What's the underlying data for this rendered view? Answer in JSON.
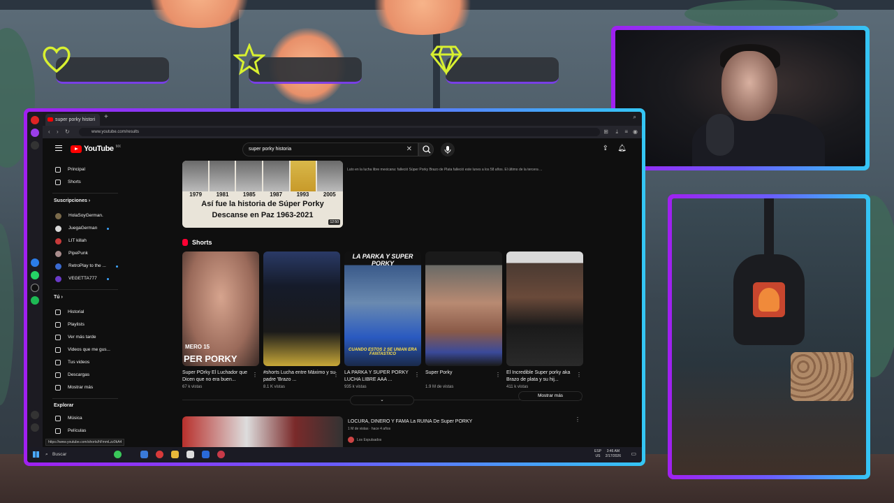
{
  "browser": {
    "tab_title": "super porky histori",
    "url": "www.youtube.com/results"
  },
  "youtube": {
    "logo": "YouTube",
    "country": "MX",
    "search_query": "super porky historia",
    "sidebar": {
      "main": [
        {
          "label": "Principal",
          "icon": "home-icon"
        },
        {
          "label": "Shorts",
          "icon": "shorts-icon"
        }
      ],
      "subscriptions_title": "Suscripciones",
      "subscriptions": [
        {
          "label": "HolaSoyGerman.",
          "color": "#7a6a4a"
        },
        {
          "label": "JuegaGerman",
          "color": "#d8d8d8"
        },
        {
          "label": "LIT killah",
          "color": "#c83a3a"
        },
        {
          "label": "PipePunk",
          "color": "#a88c8c"
        },
        {
          "label": "RetroPlay to the ...",
          "color": "#3a6ad0"
        },
        {
          "label": "VEGETTA777",
          "color": "#6a3ac8"
        }
      ],
      "you_title": "Tú",
      "you_items": [
        {
          "label": "Historial",
          "icon": "history-icon"
        },
        {
          "label": "Playlists",
          "icon": "playlist-icon"
        },
        {
          "label": "Ver más tarde",
          "icon": "clock-icon"
        },
        {
          "label": "Videos que me gus...",
          "icon": "like-icon"
        },
        {
          "label": "Tus videos",
          "icon": "video-icon"
        },
        {
          "label": "Descargas",
          "icon": "download-icon"
        },
        {
          "label": "Mostrar más",
          "icon": "chevron-down-icon"
        }
      ],
      "explore_title": "Explorar",
      "explore_items": [
        {
          "label": "Música",
          "icon": "music-icon"
        },
        {
          "label": "Películas",
          "icon": "film-icon"
        }
      ]
    },
    "top_video": {
      "years": [
        "1979",
        "1981",
        "1985",
        "1987",
        "1993",
        "2005"
      ],
      "title_line1": "Así fue la historia de Súper Porky",
      "title_line2": "Descanse en Paz 1963-2021",
      "duration": "12:50",
      "description": "Luto en la lucha libre mexicana: falleció Súper Porky Brazo de Plata falleció este lunes a los 58 años. El último de la tercera ..."
    },
    "shorts_title": "Shorts",
    "shorts": [
      {
        "title": "Super POrky El Luchador que Dicen que no era buen...",
        "views": "67 k vistas",
        "overlay": "PER PORKY",
        "sub": "MERO 15"
      },
      {
        "title": "#shorts Lucha entre Máximo y su padre 'Brazo ...",
        "views": "8.1 K vistas",
        "overlay": "",
        "sub": ""
      },
      {
        "title": "LA PARKA Y SUPER PORKY LUCHA LIBRE AAA ...",
        "views": "935 k vistas",
        "overlay": "LA PARKA Y SUPER PORKY",
        "sub": "CUANDO ESTOS 2 SE UNIAN ERA FANTASTICO"
      },
      {
        "title": "Super Porky",
        "views": "1.9 M de vistas",
        "overlay": "",
        "sub": ""
      },
      {
        "title": "El Incredible Super porky aka Brazo de plata y su hij...",
        "views": "411 k vistas",
        "overlay": "",
        "sub": ""
      }
    ],
    "show_more": "Mostrar más",
    "second_video": {
      "title": "LOCURA, DINERO Y FAMA La RUINA De Super PORKY",
      "stats": "1 M de vistas · hace 4 años",
      "channel": "Los Expulsados"
    },
    "status_url": "https://www.youtube.com/shorts/hFmmLzz0kA4"
  },
  "taskbar": {
    "search_label": "Buscar",
    "lang_line1": "ESP",
    "lang_line2": "US",
    "time": "3:46 AM",
    "date": "2/17/2026"
  }
}
